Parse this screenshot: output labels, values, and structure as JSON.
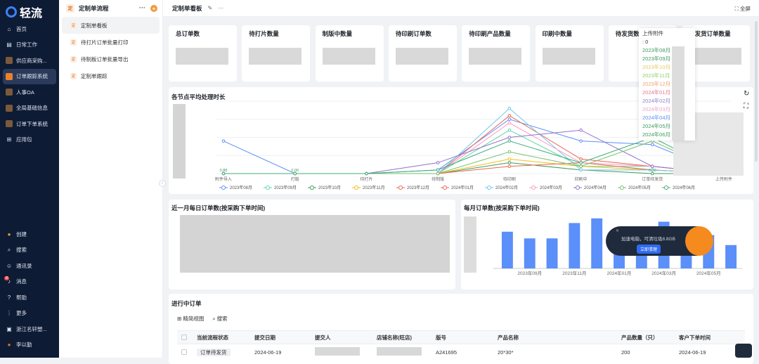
{
  "app": {
    "name": "轻流"
  },
  "nav": {
    "items": [
      {
        "label": "首页",
        "icon": "home-icon"
      },
      {
        "label": "日常工作",
        "icon": "daily-icon"
      },
      {
        "label": "供应商采购...",
        "icon": "supplier-icon"
      },
      {
        "label": "订单跟踪系统",
        "icon": "order-track-icon",
        "active": true
      },
      {
        "label": "人事OA",
        "icon": "hr-icon"
      },
      {
        "label": "全局基础信息",
        "icon": "global-icon"
      },
      {
        "label": "订单下单系统",
        "icon": "order-place-icon"
      },
      {
        "label": "应用包",
        "icon": "apps-icon"
      }
    ],
    "bottom": [
      {
        "label": "创建",
        "icon": "create-icon"
      },
      {
        "label": "搜索",
        "icon": "search-icon"
      },
      {
        "label": "通讯录",
        "icon": "contacts-icon"
      },
      {
        "label": "消息",
        "icon": "bell-icon"
      },
      {
        "label": "帮助",
        "icon": "help-icon"
      },
      {
        "label": "更多",
        "icon": "more-grid-icon"
      },
      {
        "label": "浙江名轩塑...",
        "icon": "company-icon"
      },
      {
        "label": "李以勤",
        "icon": "avatar"
      }
    ],
    "badge": "8"
  },
  "subnav": {
    "title": "定制单流程",
    "items": [
      {
        "label": "定制单看板",
        "active": true
      },
      {
        "label": "待打片订单批量打印"
      },
      {
        "label": "待制板订单批量导出"
      },
      {
        "label": "定制单跟踪"
      }
    ]
  },
  "topbar": {
    "title": "定制单看板",
    "fullscreen": "全屏"
  },
  "kpis": [
    "总订单数",
    "待打片数量",
    "制版中数量",
    "待印刷订单数",
    "待印刷产品数量",
    "印刷中数量",
    "待发货数",
    "已发货订单数量"
  ],
  "tooltip": {
    "header": "上传附件",
    "value": ": 0",
    "rows": [
      "2023年08月",
      "2023年09月",
      "2023年10月",
      "2023年11月",
      "2023年12月",
      "2024年01月",
      "2024年02月",
      "2024年03月",
      "2024年04月",
      "2024年05月",
      "2024年06月"
    ]
  },
  "sections": {
    "line_title": "各节点平均处理时长",
    "daily_title": "近一月每日订单数(按采购下单时间)",
    "monthly_title": "每月订单数(按采购下单时间)",
    "table_title": "进行中订单"
  },
  "chart_data": [
    {
      "type": "line",
      "title": "各节点平均处理时长",
      "categories": [
        "附件导入",
        "打版",
        "待打片",
        "待制版",
        "待印刷",
        "印刷中",
        "订单待发货",
        "上传附件"
      ],
      "series": [
        {
          "name": "2023年08月",
          "values": [
            0.9,
            0,
            0,
            0.1,
            1.5,
            0.9,
            0.8,
            0
          ]
        },
        {
          "name": "2023年09月",
          "values": [
            0,
            0,
            0,
            0,
            1.2,
            0.2,
            0.2,
            0
          ]
        },
        {
          "name": "2023年10月",
          "values": [
            0,
            0,
            0,
            0,
            0.3,
            0.1,
            0,
            0
          ]
        },
        {
          "name": "2023年11月",
          "values": [
            0,
            0,
            0,
            0,
            0.4,
            0.2,
            0.1,
            0
          ]
        },
        {
          "name": "2023年12月",
          "values": [
            0,
            0,
            0,
            0,
            0.2,
            0.3,
            0.1,
            0
          ]
        },
        {
          "name": "2024年01月",
          "values": [
            0,
            0,
            0,
            0,
            1.6,
            0.4,
            0.2,
            0
          ]
        },
        {
          "name": "2024年02月",
          "values": [
            0,
            0,
            0,
            0,
            1.8,
            0.1,
            0.1,
            0
          ]
        },
        {
          "name": "2024年03月",
          "values": [
            0,
            0,
            0,
            0,
            1.4,
            0.3,
            0.2,
            0
          ]
        },
        {
          "name": "2024年04月",
          "values": [
            0,
            0,
            0,
            0.3,
            1.0,
            1.2,
            0.2,
            0
          ]
        },
        {
          "name": "2024年05月",
          "values": [
            0,
            0,
            0,
            0,
            0.6,
            0.2,
            0.9,
            0
          ]
        },
        {
          "name": "2024年06月",
          "values": [
            0,
            0,
            0,
            0.1,
            0.9,
            0.3,
            1.0,
            0
          ]
        }
      ],
      "labels": {
        "附件导入": "0.88",
        "打版": "0.00",
        "订单待发货": "0.00"
      },
      "grid": true,
      "legend": "bottom"
    },
    {
      "type": "bar",
      "title": "每月订单数(按采购下单时间)",
      "categories": [
        "2023年08月",
        "2023年09月",
        "2023年10月",
        "2023年11月",
        "2023年12月",
        "2024年01月",
        "2024年02月",
        "2024年03月",
        "2024年04月",
        "2024年05月",
        "2024年06月"
      ],
      "x_tick_labels": [
        "2023年09月",
        "2023年11月",
        "2024年01月",
        "2024年03月",
        "2024年05月"
      ],
      "values": [
        55,
        45,
        45,
        68,
        75,
        50,
        45,
        70,
        60,
        50,
        35
      ],
      "color": "#5b8ff9"
    }
  ],
  "banner": {
    "text": "加速电脑，可清垃圾8.8GB",
    "button": "立即清理"
  },
  "table": {
    "tools": [
      "精简视图",
      "搜索"
    ],
    "headers": [
      "当前流程状态",
      "提交日期",
      "提交人",
      "店铺名称(旺店)",
      "版号",
      "产品名称",
      "产品数量（只）",
      "客户下单时间"
    ],
    "rows": [
      [
        "订单待发货",
        "2024-06-19",
        "",
        "",
        "A241695",
        "20*30*",
        "200",
        "2024-06-19"
      ]
    ]
  }
}
